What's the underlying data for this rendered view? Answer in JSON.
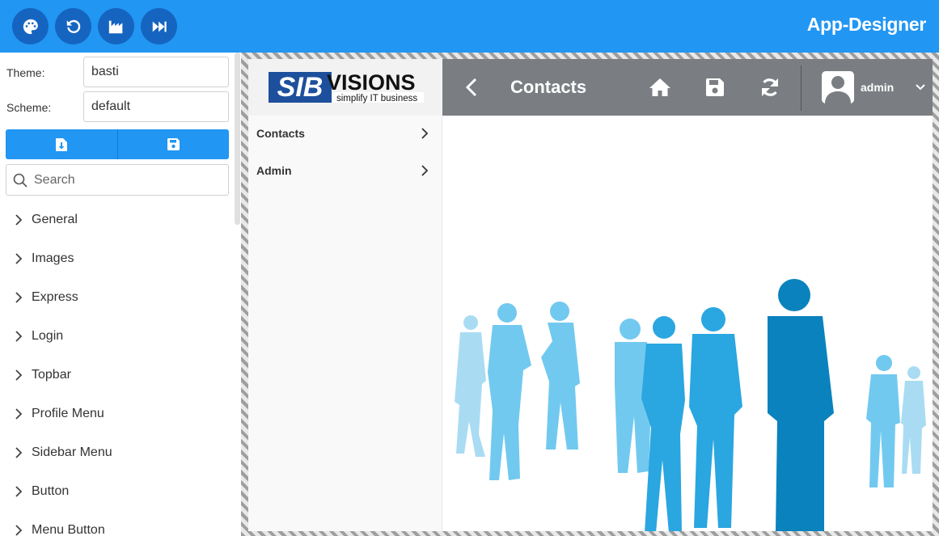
{
  "topbar": {
    "title": "App-Designer",
    "buttons": [
      "palette-icon",
      "undo-icon",
      "factory-icon",
      "fast-forward-icon"
    ],
    "color": "#2196F3"
  },
  "designer": {
    "theme_label": "Theme:",
    "theme_value": "basti",
    "scheme_label": "Scheme:",
    "scheme_value": "default",
    "action_buttons": [
      "file-download-icon",
      "save-icon"
    ],
    "search_placeholder": "Search",
    "sections": [
      "General",
      "Images",
      "Express",
      "Login",
      "Topbar",
      "Profile Menu",
      "Sidebar Menu",
      "Button",
      "Menu Button"
    ]
  },
  "preview": {
    "logo": {
      "sib": "SIB",
      "visions": "VISIONS",
      "tagline": "simplify IT business"
    },
    "menu": [
      {
        "label": "Contacts"
      },
      {
        "label": "Admin"
      }
    ],
    "header": {
      "title": "Contacts",
      "user": "admin",
      "color": "#7a7e82",
      "icons": [
        "back-icon",
        "home-icon",
        "save-icon",
        "refresh-icon",
        "avatar-icon",
        "chevron-down-icon"
      ]
    }
  }
}
